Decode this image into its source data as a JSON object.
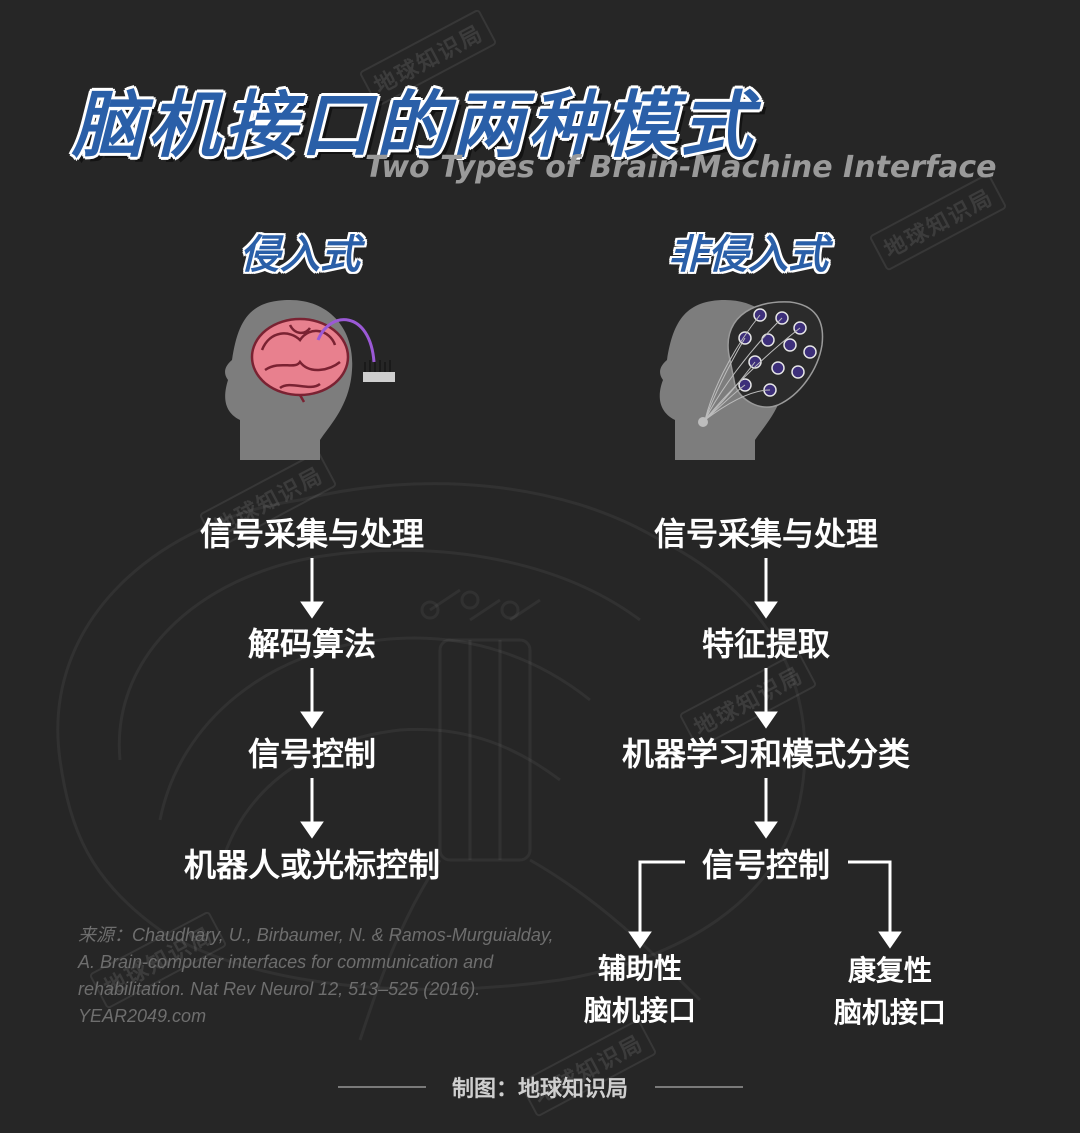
{
  "title": "脑机接口的两种模式",
  "subtitle": "Two Types of Brain-Machine Interface",
  "watermark": "地球知识局",
  "invasive": {
    "heading": "侵入式",
    "steps": [
      "信号采集与处理",
      "解码算法",
      "信号控制",
      "机器人或光标控制"
    ]
  },
  "noninvasive": {
    "heading": "非侵入式",
    "steps": [
      "信号采集与处理",
      "特征提取",
      "机器学习和模式分类",
      "信号控制"
    ],
    "branches": [
      {
        "line1": "辅助性",
        "line2": "脑机接口"
      },
      {
        "line1": "康复性",
        "line2": "脑机接口"
      }
    ]
  },
  "source": {
    "lines": [
      "来源：Chaudhary, U., Birbaumer, N. & Ramos-Murguialday,",
      "A. Brain-computer interfaces for communication and",
      "rehabilitation. Nat Rev Neurol 12, 513–525 (2016).",
      "YEAR2049.com"
    ]
  },
  "credit": "制图：地球知识局",
  "colors": {
    "background": "#262626",
    "title_blue": "#2a5fa8",
    "brain_pink": "#e8808e",
    "head_gray": "#7d7d7d",
    "electrode_purple": "#6a4fb3"
  }
}
